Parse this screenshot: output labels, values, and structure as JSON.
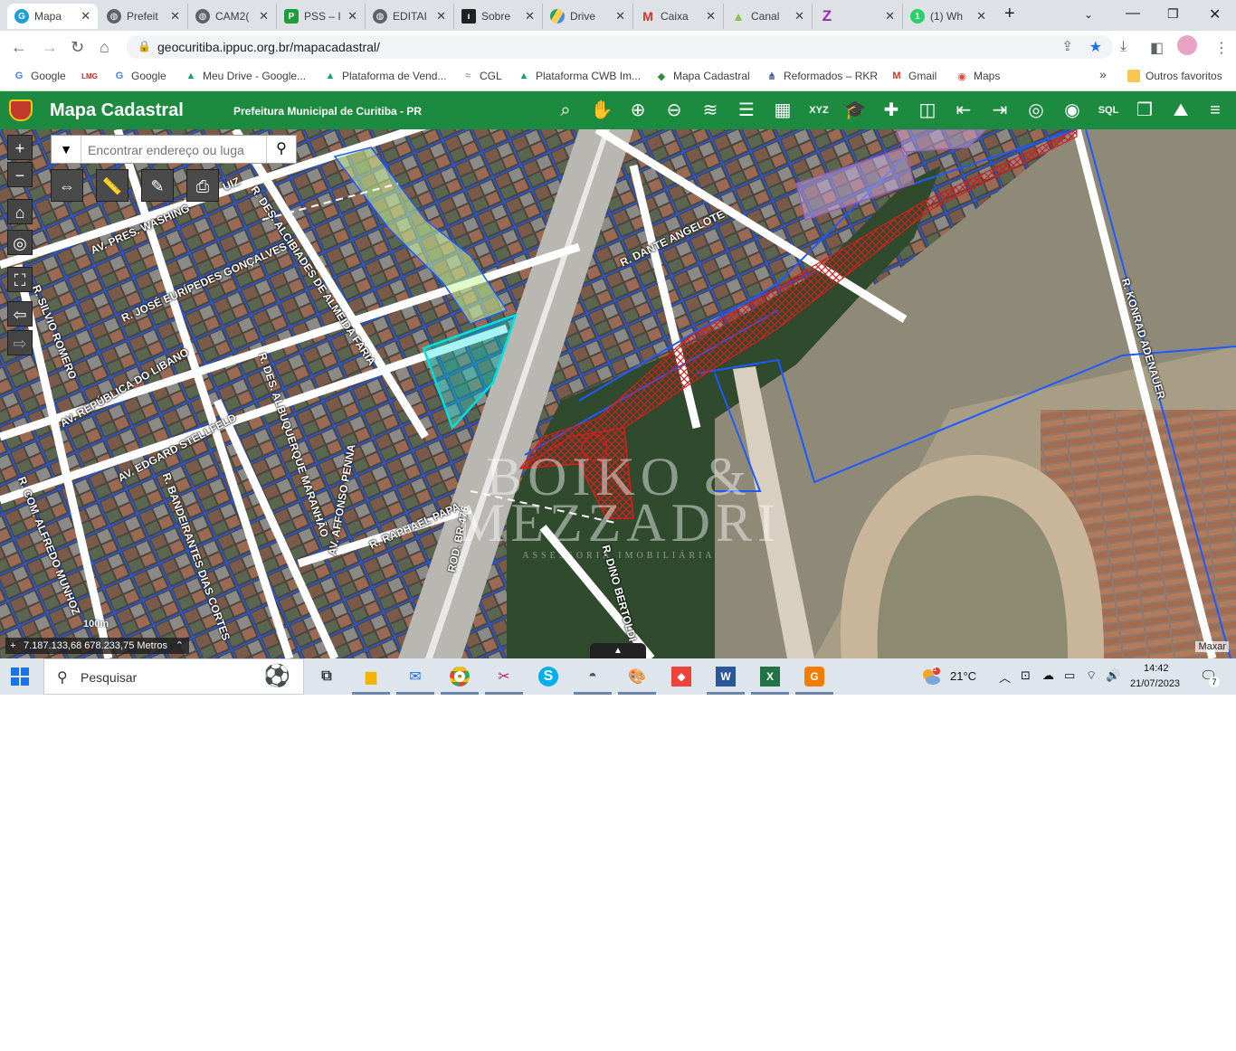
{
  "browser": {
    "tabs": [
      {
        "title": "Mapa",
        "icon": "geocuritiba-icon",
        "active": true
      },
      {
        "title": "Prefeit",
        "icon": "globe-icon"
      },
      {
        "title": "CAM2(",
        "icon": "globe-icon"
      },
      {
        "title": "PSS – I",
        "icon": "pss-icon"
      },
      {
        "title": "EDITAI",
        "icon": "globe-icon"
      },
      {
        "title": "Sobre",
        "icon": "sobre-icon"
      },
      {
        "title": "Drive",
        "icon": "drive-icon"
      },
      {
        "title": "Caixa",
        "icon": "gmail-icon"
      },
      {
        "title": "Canal",
        "icon": "canal-icon"
      },
      {
        "title": "",
        "icon": "z-icon"
      },
      {
        "title": "(1) Wh",
        "icon": "whatsapp-icon"
      }
    ],
    "new_tab": "+",
    "url": "geocuritiba.ippuc.org.br/mapacadastral/",
    "bookmarks": [
      {
        "label": "Google",
        "icon": "google-icon"
      },
      {
        "label": "",
        "icon": "lmg-icon"
      },
      {
        "label": "Google",
        "icon": "google-icon"
      },
      {
        "label": "Meu Drive - Google...",
        "icon": "drive-icon"
      },
      {
        "label": "Plataforma de Vend...",
        "icon": "drive-icon"
      },
      {
        "label": "CGL",
        "icon": "cgl-icon"
      },
      {
        "label": "Plataforma CWB Im...",
        "icon": "drive-icon"
      },
      {
        "label": "Mapa Cadastral",
        "icon": "mapa-icon"
      },
      {
        "label": "Reformados – RKR",
        "icon": "rkr-icon"
      },
      {
        "label": "Gmail",
        "icon": "gmail-icon"
      },
      {
        "label": "Maps",
        "icon": "maps-icon"
      }
    ],
    "bookmarks_more": "»",
    "other_favorites": "Outros favoritos"
  },
  "app": {
    "title": "Mapa Cadastral",
    "subtitle": "Prefeitura Municipal de Curitiba - PR",
    "tools": [
      "identify-icon",
      "pan-icon",
      "zoom-in-icon",
      "zoom-out-icon",
      "layers-icon",
      "legend-icon",
      "grid-icon",
      "xyz-icon",
      "education-icon",
      "add-layer-icon",
      "split-icon",
      "import-icon",
      "export-icon",
      "locate-icon",
      "globe-icon",
      "sql-icon",
      "overlay-icon",
      "terrain-icon",
      "menu-icon"
    ],
    "xyz_label": "XYZ",
    "sql_label": "SQL"
  },
  "map": {
    "search_placeholder": "Encontrar endereço ou luga",
    "zoom_in": "+",
    "zoom_out": "−",
    "streets": [
      "AV. PRES. WASHING",
      "R. DES. ALCIBIADES DE ALMEIDA FARIA",
      "R. JOSÉ EURÍPEDES GONÇALVES",
      "R. SILVIO ROMERO",
      "AV. REPÚBLICA DO LIBANO",
      "R. DES. ALBUQUERQUE MARANHÃO",
      "AV. EDGARD STELLFELD",
      "R. BANDEIRANTES DIAS CORTES",
      "R. COM. ALFREDO MUNHOZ",
      "AV. AFFONSO PENNA",
      "R. RAPHAEL PAPA",
      "ROD. BR-476",
      "R. DANTE ANGELOTE",
      "R. DINO BERTOLDI",
      "R. KONRAD ADENAUER",
      "UIZ"
    ],
    "watermark": {
      "line1": "BOIKO &",
      "line2": "MEZZADRI",
      "line3": "ASSESSORIA IMOBILIÁRIA"
    },
    "scale": "100m",
    "coordinates": "7.187.133,68 678.233,75 Metros",
    "attribution": "Maxar",
    "colors": {
      "parcel": "#1e5bff",
      "highlight": "#00e0e0",
      "hatch": "#d0201e",
      "green_area": "#c9f29a",
      "header": "#1d8b3f"
    }
  },
  "taskbar": {
    "search_label": "Pesquisar",
    "weather_temp": "21°C",
    "weather_badge": "1",
    "time": "14:42",
    "date": "21/07/2023",
    "notifications": "7",
    "apps": [
      {
        "icon": "task-view-icon"
      },
      {
        "icon": "file-explorer-icon"
      },
      {
        "icon": "mail-icon"
      },
      {
        "icon": "chrome-icon"
      },
      {
        "icon": "snipping-icon"
      },
      {
        "icon": "skype-icon"
      },
      {
        "icon": "ftp-icon"
      },
      {
        "icon": "paint-icon"
      },
      {
        "icon": "anydesk-icon"
      },
      {
        "icon": "word-icon"
      },
      {
        "icon": "excel-icon"
      },
      {
        "icon": "pdf-icon"
      }
    ]
  }
}
